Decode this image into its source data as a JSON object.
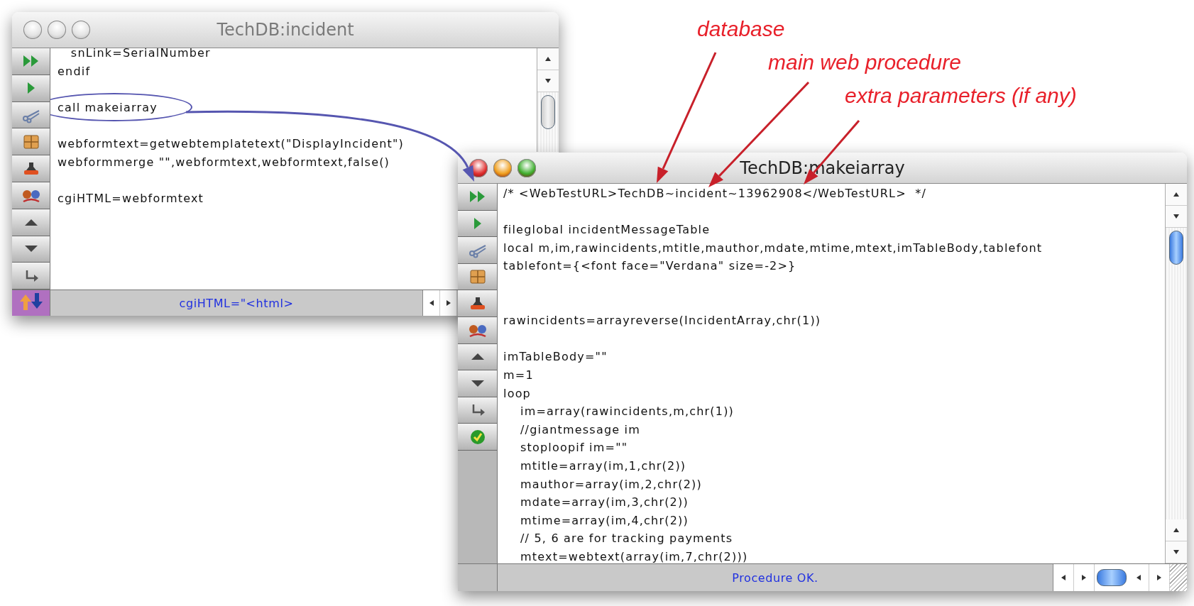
{
  "annotations": [
    {
      "text": "database"
    },
    {
      "text": "main web procedure"
    },
    {
      "text": "extra parameters (if any)"
    }
  ],
  "windows": [
    {
      "title": "TechDB:incident",
      "active": false,
      "navigator": true,
      "toolbar": [
        {
          "kind": "fast-forward"
        },
        {
          "kind": "play"
        },
        {
          "kind": "scissors"
        },
        {
          "kind": "puzzle"
        },
        {
          "kind": "stamp"
        },
        {
          "kind": "figures"
        },
        {
          "kind": "up"
        },
        {
          "kind": "down"
        },
        {
          "kind": "return"
        }
      ],
      "lines": [
        {
          "kind": "code",
          "text": "   snLink=SerialNumber"
        },
        {
          "kind": "code",
          "text": "endif"
        },
        {
          "kind": "blank"
        },
        {
          "kind": "code",
          "text": "call makeiarray",
          "circled": true
        },
        {
          "kind": "blank"
        },
        {
          "kind": "code",
          "text": "webformtext=getwebtemplatetext(\"DisplayIncident\")"
        },
        {
          "kind": "code",
          "text": "webformmerge \"\",webformtext,webformtext,false()"
        },
        {
          "kind": "blank"
        },
        {
          "kind": "code",
          "text": "cgiHTML=webformtext"
        }
      ],
      "status": "cgiHTML=\"<html>"
    },
    {
      "title": "TechDB:makeiarray",
      "active": true,
      "navigator": false,
      "toolbar": [
        {
          "kind": "fast-forward"
        },
        {
          "kind": "play"
        },
        {
          "kind": "scissors"
        },
        {
          "kind": "puzzle"
        },
        {
          "kind": "stamp"
        },
        {
          "kind": "figures"
        },
        {
          "kind": "up"
        },
        {
          "kind": "down"
        },
        {
          "kind": "return"
        },
        {
          "kind": "check"
        }
      ],
      "lines": [
        {
          "kind": "code",
          "text": "/* <WebTestURL>TechDB~incident~13962908</WebTestURL>  */"
        },
        {
          "kind": "blank"
        },
        {
          "kind": "code",
          "text": "fileglobal incidentMessageTable"
        },
        {
          "kind": "code",
          "text": "local m,im,rawincidents,mtitle,mauthor,mdate,mtime,mtext,imTableBody,tablefont"
        },
        {
          "kind": "code",
          "text": "tablefont={<font face=\"Verdana\" size=-2>}"
        },
        {
          "kind": "blank"
        },
        {
          "kind": "blank"
        },
        {
          "kind": "code",
          "text": "rawincidents=arrayreverse(IncidentArray,chr(1))"
        },
        {
          "kind": "blank"
        },
        {
          "kind": "code",
          "text": "imTableBody=\"\""
        },
        {
          "kind": "code",
          "text": "m=1"
        },
        {
          "kind": "code",
          "text": "loop",
          "children": [
            {
              "kind": "code",
              "text": "im=array(rawincidents,m,chr(1))"
            },
            {
              "kind": "code",
              "text": "//giantmessage im"
            },
            {
              "kind": "code",
              "text": "stoploopif im=\"\""
            },
            {
              "kind": "code",
              "text": "mtitle=array(im,1,chr(2))"
            },
            {
              "kind": "code",
              "text": "mauthor=array(im,2,chr(2))"
            },
            {
              "kind": "code",
              "text": "mdate=array(im,3,chr(2))"
            },
            {
              "kind": "code",
              "text": "mtime=array(im,4,chr(2))"
            },
            {
              "kind": "code",
              "text": "// 5, 6 are for tracking payments"
            },
            {
              "kind": "code",
              "text": "mtext=webtext(array(im,7,chr(2)))"
            }
          ]
        }
      ],
      "status": "Procedure OK."
    }
  ]
}
